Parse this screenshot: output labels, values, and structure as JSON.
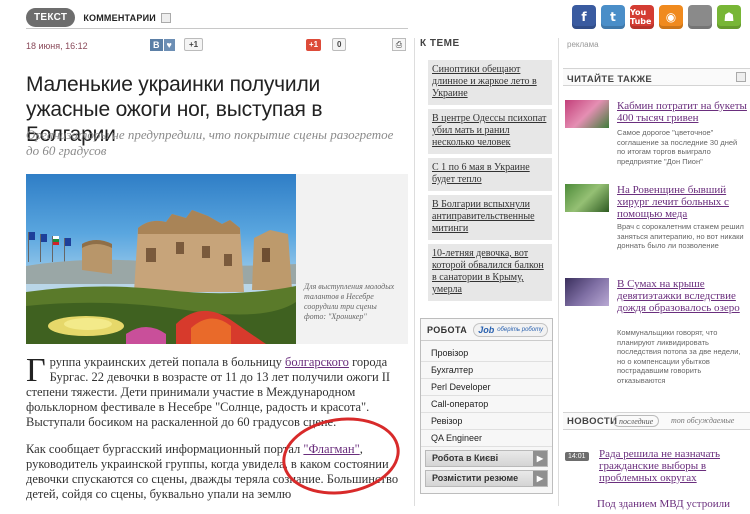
{
  "tabs": {
    "active": "ТЕКСТ",
    "comments": "КОММЕНТАРИИ"
  },
  "social": [
    {
      "name": "facebook",
      "glyph": "f",
      "color": "#3a5ba0"
    },
    {
      "name": "twitter",
      "glyph": "t",
      "color": "#4a8ec8"
    },
    {
      "name": "youtube",
      "glyph": "You Tube",
      "color": "#d43c32"
    },
    {
      "name": "rss",
      "glyph": "◉",
      "color": "#f08a1e"
    },
    {
      "name": "apple",
      "glyph": "",
      "color": "#8a8a8a"
    },
    {
      "name": "android",
      "glyph": "☗",
      "color": "#78b636"
    }
  ],
  "meta": {
    "date": "18 июня, 16:12",
    "vk_b": "В",
    "vk_heart": "♥",
    "vk_count": "+1",
    "gplus": "+1",
    "gplus_count": "0",
    "print_icon": "⎙"
  },
  "article": {
    "headline": "Маленькие украинки получили ужасные ожоги ног, выступая в Болгарии",
    "lead": "Организаторы не предупредили, что покрытие сцены разогретое до 60 градусов",
    "caption": "Для выступления молодых талантов в Несебре соорудили три сцены",
    "caption_credit": "фото: \"Хроникер\"",
    "dropcap": "Г",
    "p1_start": "руппа украинских детей попала в больницу ",
    "p1_link": "болгарского",
    "p1_end": " города Бургас. 22 девочки в возрасте от 11 до 13 лет получили ожоги II степени тяжести. Дети принимали участие в Международном фольклорном фестивале в Несебре \"Солнце, радость и красота\". Выступали босиком на раскаленной до 60 градусов сцене.",
    "p2_start": "Как сообщает бургасский информационный портал ",
    "p2_link": "\"Флагман\"",
    "p2_end": ", руководитель украинской группы, когда увидела, в каком состоянии девочки спускаются со сцены, дважды теряла сознание. Большинство детей, сойдя со сцены, буквально упали на землю"
  },
  "theme": {
    "title": "К ТЕМЕ",
    "items": [
      "Синоптики обещают длинное и жаркое лето в Украине",
      "В центре Одессы психопат убил мать и ранил несколько человек",
      "С 1 по 6 мая в Украине будет тепло",
      "В Болгарии вспыхнули антиправительственные митинги",
      "10-летняя девочка, вот которой обвалился балкон в санатории в Крыму, умерла"
    ]
  },
  "jobs": {
    "title": "РОБОТА",
    "logo_main": "Job",
    "logo_sub": "оберіть роботу",
    "items": [
      "Провізор",
      "Бухгалтер",
      "Perl Developer",
      "Call-оператор",
      "Ревізор",
      "QA Engineer"
    ],
    "btn_city": "Робота в Києві",
    "btn_post": "Розмістити резюме",
    "arrow": "▶"
  },
  "right": {
    "ad_label": "реклама",
    "also_title": "ЧИТАЙТЕ ТАКЖЕ",
    "stories": [
      {
        "title": "Кабмин потратит на букеты 400 тысяч гривен",
        "text": "Самое дорогое \"цветочное\" соглашение за последние 30 дней по итогам торгов выиграло предприятие \"Дон Пион\""
      },
      {
        "title": "На Ровенщине бывший хирург лечит больных с помощью меда",
        "text": "Врач с сорокалетним стажем решил заняться апитерапию, но вот никаки доннать было ли позволение"
      },
      {
        "title": "В Сумах на крыше девятиэтажки вследствие дождя образовалось озеро",
        "text": "Коммунальщики говорят, что планируют ликвидировать последствия потопа за две недели, но о компенсации убытков пострадавшим говорить отказываются"
      }
    ],
    "news_title": "НОВОСТИ",
    "news_tab_last": "последние",
    "news_tab_top": "топ обсуждаемые",
    "news_time": "14:01",
    "news_text": "Рада решила не назначать гражданские выборы в проблемных округах",
    "news_next": "Под зданием МВД устроили"
  }
}
